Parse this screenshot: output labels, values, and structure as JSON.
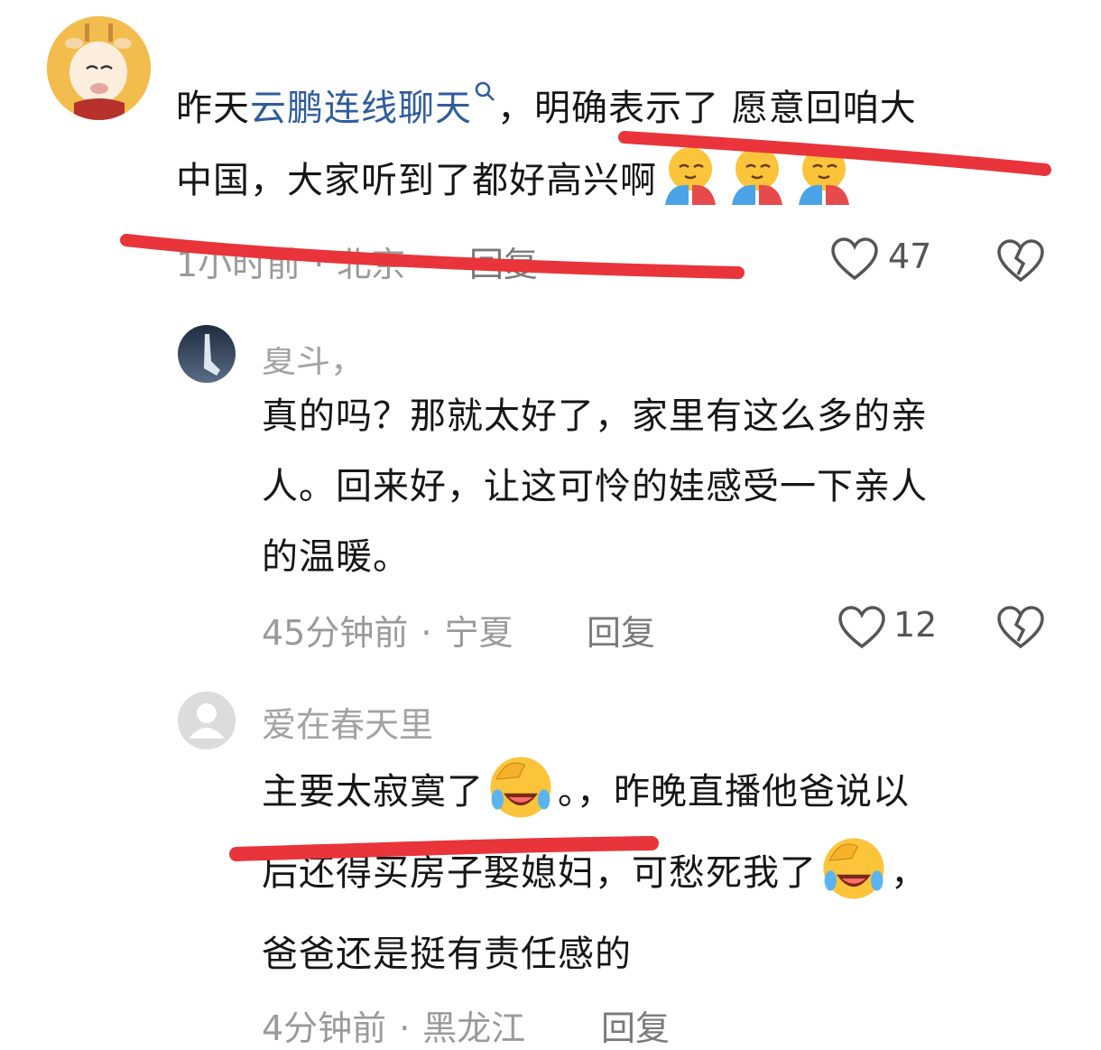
{
  "comments": [
    {
      "text_before": "昨天",
      "link": "云鹏连线聊天",
      "text_line1_after": "，明确表示了 愿意回咱大",
      "text_line2": "中国，大家听到了都好高兴啊",
      "time": "1小时前",
      "location": "北京",
      "reply": "回复",
      "likes": "47"
    },
    {
      "username": "夏斗，",
      "line1": "真的吗？那就太好了，家里有这么多的亲",
      "line2": "人。回来好，让这可怜的娃感受一下亲人",
      "line3": "的温暖。",
      "time": "45分钟前",
      "location": "宁夏",
      "reply": "回复",
      "likes": "12"
    },
    {
      "username": "爱在春天里",
      "line1_a": "主要太寂寞了",
      "line1_b": "。，昨晚直播他爸说以",
      "line2_a": "后还得买房子娶媳妇，可愁死我了",
      "line2_b": "，",
      "line3": "爸爸还是挺有责任感的",
      "time": "4分钟前",
      "location": "黑龙江",
      "reply": "回复"
    }
  ],
  "colors": {
    "link": "#2f5c9c",
    "annotation_red": "#e8343a",
    "meta": "#9a9a9a"
  },
  "icons": [
    "search-icon",
    "heart-outline-icon",
    "broken-heart-icon",
    "blush-hug-emoji",
    "laughing-crying-emoji"
  ]
}
